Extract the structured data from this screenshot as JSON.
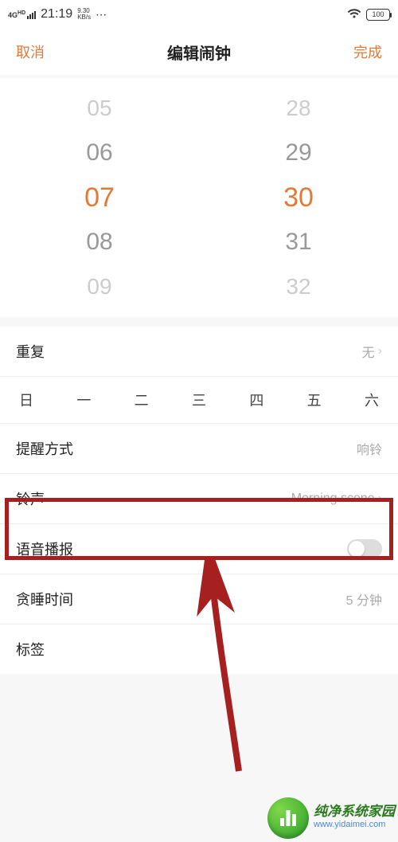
{
  "status": {
    "net_type": "4G",
    "net_sub": "HD",
    "time": "21:19",
    "speed_val": "9.30",
    "speed_unit": "KB/s",
    "battery": "100"
  },
  "header": {
    "cancel": "取消",
    "title": "编辑闹钟",
    "done": "完成"
  },
  "picker": {
    "hours": [
      "05",
      "06",
      "07",
      "08",
      "09"
    ],
    "minutes": [
      "28",
      "29",
      "30",
      "31",
      "32"
    ],
    "selected_hour": "07",
    "selected_minute": "30"
  },
  "weekdays": [
    "日",
    "一",
    "二",
    "三",
    "四",
    "五",
    "六"
  ],
  "rows": {
    "repeat": {
      "label": "重复",
      "value": "无"
    },
    "alert": {
      "label": "提醒方式",
      "value": "响铃"
    },
    "ring": {
      "label": "铃声",
      "value": "Morning scene"
    },
    "voice": {
      "label": "语音播报"
    },
    "snooze": {
      "label": "贪睡时间",
      "value": "5 分钟"
    },
    "tag": {
      "label": "标签"
    }
  },
  "watermark": {
    "title": "纯净系统家园",
    "url": "www.yidaimei.com"
  },
  "colors": {
    "accent": "#e27a36",
    "annotation": "#a62020"
  }
}
